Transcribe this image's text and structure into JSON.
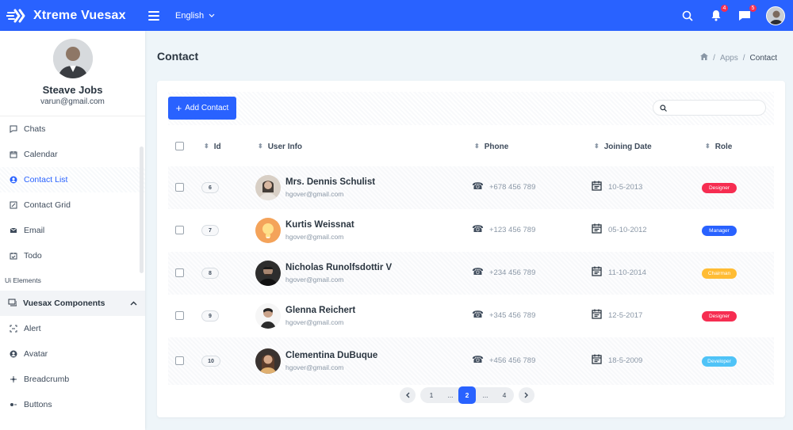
{
  "app": {
    "brand": "Xtreme Vuesax",
    "language": "English"
  },
  "notifications": {
    "bell_count": "4",
    "message_count": "5"
  },
  "sidebar": {
    "profile": {
      "name": "Steave Jobs",
      "email": "varun@gmail.com"
    },
    "items": [
      {
        "label": "Chats",
        "icon": "chat-icon"
      },
      {
        "label": "Calendar",
        "icon": "calendar-icon"
      },
      {
        "label": "Contact List",
        "icon": "user-circle-icon",
        "active": true
      },
      {
        "label": "Contact Grid",
        "icon": "edit-square-icon"
      },
      {
        "label": "Email",
        "icon": "mail-icon"
      },
      {
        "label": "Todo",
        "icon": "todo-icon"
      }
    ],
    "section_label": "Ui Elements",
    "group": {
      "label": "Vuesax Components",
      "icon": "layers-icon"
    },
    "sub_items": [
      {
        "label": "Alert",
        "icon": "alert-icon"
      },
      {
        "label": "Avatar",
        "icon": "avatar-icon"
      },
      {
        "label": "Breadcrumb",
        "icon": "breadcrumb-icon"
      },
      {
        "label": "Buttons",
        "icon": "buttons-icon"
      }
    ]
  },
  "page": {
    "title": "Contact",
    "breadcrumb": [
      "Apps",
      "Contact"
    ]
  },
  "toolbar": {
    "add_label": "Add Contact",
    "search_placeholder": ""
  },
  "table": {
    "headers": {
      "id": "Id",
      "user": "User Info",
      "phone": "Phone",
      "joining": "Joining Date",
      "role": "Role"
    },
    "rows": [
      {
        "id": "6",
        "name": "Mrs. Dennis Schulist",
        "email": "hgover@gmail.com",
        "phone": "+678 456 789",
        "date": "10-5-2013",
        "role": "Designer",
        "role_color": "#f62d51",
        "avatar_color": "#d8cfc5"
      },
      {
        "id": "7",
        "name": "Kurtis Weissnat",
        "email": "hgover@gmail.com",
        "phone": "+123 456 789",
        "date": "05-10-2012",
        "role": "Manager",
        "role_color": "#2962ff",
        "avatar_color": "#f4a35a"
      },
      {
        "id": "8",
        "name": "Nicholas Runolfsdottir V",
        "email": "hgover@gmail.com",
        "phone": "+234 456 789",
        "date": "11-10-2014",
        "role": "Chairman",
        "role_color": "#ffbc34",
        "avatar_color": "#2d2d2d"
      },
      {
        "id": "9",
        "name": "Glenna Reichert",
        "email": "hgover@gmail.com",
        "phone": "+345 456 789",
        "date": "12-5-2017",
        "role": "Designer",
        "role_color": "#f62d51",
        "avatar_color": "#f2f2f2"
      },
      {
        "id": "10",
        "name": "Clementina DuBuque",
        "email": "hgover@gmail.com",
        "phone": "+456 456 789",
        "date": "18-5-2009",
        "role": "Developer",
        "role_color": "#4fc3f7",
        "avatar_color": "#3a3330"
      }
    ]
  },
  "pagination": {
    "first": "1",
    "ellipsis_left": "...",
    "current": "2",
    "ellipsis_right": "...",
    "last": "4"
  },
  "colors": {
    "primary": "#2962ff",
    "danger": "#f62d51",
    "warning": "#ffbc34",
    "info": "#4fc3f7"
  }
}
